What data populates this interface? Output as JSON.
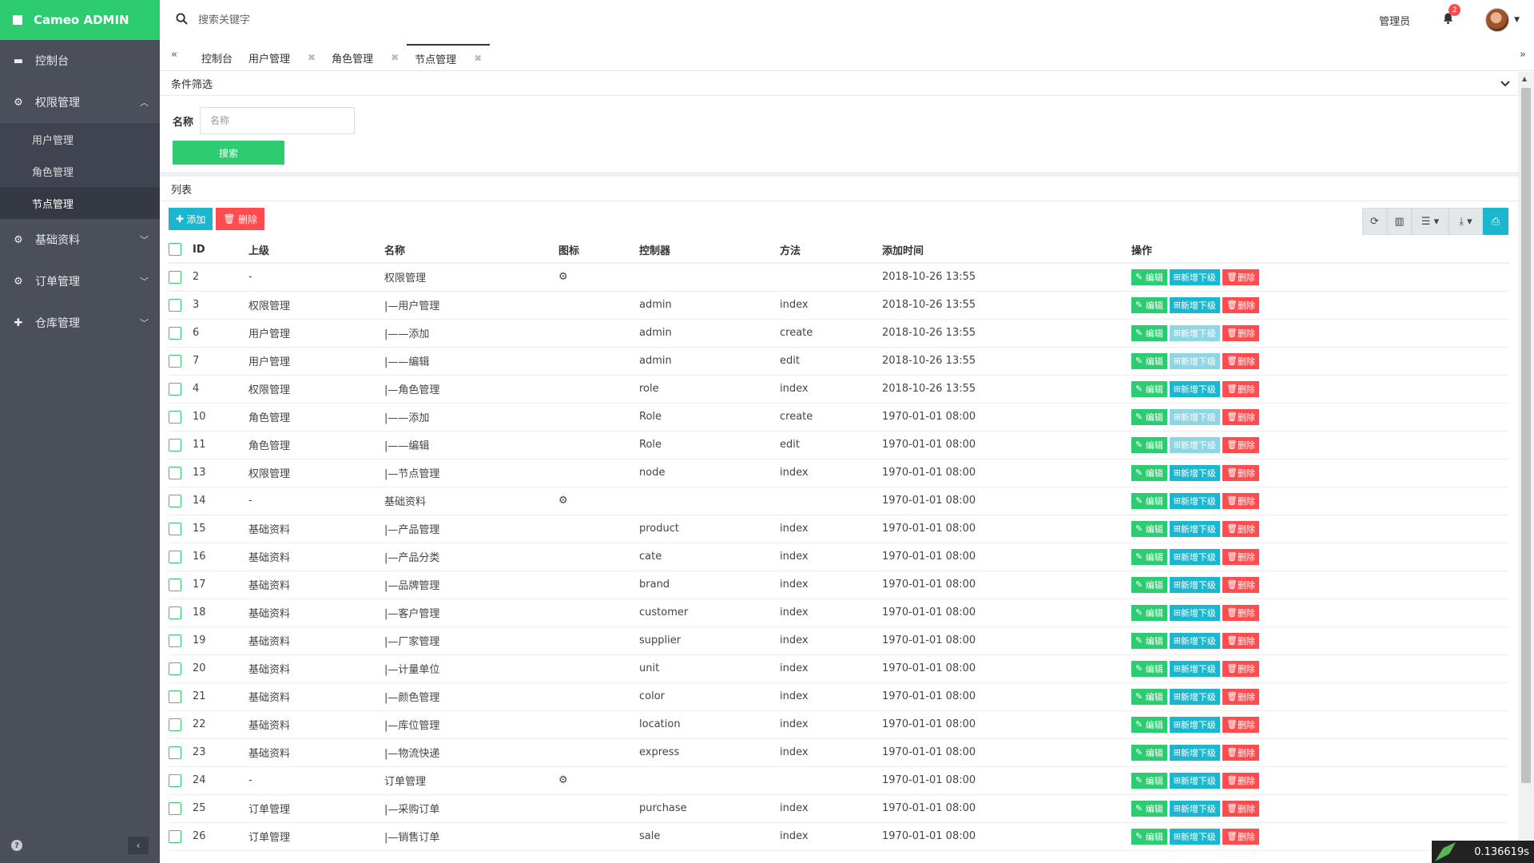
{
  "brand": {
    "title": "Cameo ADMIN"
  },
  "sidebar": {
    "items": [
      {
        "label": "控制台",
        "icon": "dashboard-icon"
      },
      {
        "label": "权限管理",
        "icon": "gears-icon",
        "expanded": true,
        "children": [
          {
            "label": "用户管理"
          },
          {
            "label": "角色管理"
          },
          {
            "label": "节点管理",
            "active": true
          }
        ]
      },
      {
        "label": "基础资料",
        "icon": "gears-icon"
      },
      {
        "label": "订单管理",
        "icon": "gears-icon"
      },
      {
        "label": "仓库管理",
        "icon": "plus-icon"
      }
    ]
  },
  "header": {
    "search_placeholder": "搜索关键字",
    "admin_name": "管理员",
    "notification_count": "2"
  },
  "tabs": [
    {
      "label": "控制台",
      "closable": false
    },
    {
      "label": "用户管理",
      "closable": true
    },
    {
      "label": "角色管理",
      "closable": true
    },
    {
      "label": "节点管理",
      "closable": true,
      "active": true
    }
  ],
  "filter": {
    "title": "条件筛选",
    "name_label": "名称",
    "name_placeholder": "名称",
    "search_button": "搜索"
  },
  "list": {
    "title": "列表",
    "add_button": "添加",
    "delete_button": "删除",
    "columns": [
      "ID",
      "上级",
      "名称",
      "图标",
      "控制器",
      "方法",
      "添加时间",
      "操作"
    ],
    "actions": {
      "edit": "编辑",
      "add_child": "新增下级",
      "delete": "删除"
    },
    "rows": [
      {
        "id": "2",
        "parent": "-",
        "name": "权限管理",
        "icon": true,
        "controller": "",
        "method": "",
        "time": "2018-10-26 13:55",
        "add_child_enabled": true
      },
      {
        "id": "3",
        "parent": "权限管理",
        "name": "|—用户管理",
        "icon": false,
        "controller": "admin",
        "method": "index",
        "time": "2018-10-26 13:55",
        "add_child_enabled": true
      },
      {
        "id": "6",
        "parent": "用户管理",
        "name": "|——添加",
        "icon": false,
        "controller": "admin",
        "method": "create",
        "time": "2018-10-26 13:55",
        "add_child_enabled": false
      },
      {
        "id": "7",
        "parent": "用户管理",
        "name": "|——编辑",
        "icon": false,
        "controller": "admin",
        "method": "edit",
        "time": "2018-10-26 13:55",
        "add_child_enabled": false
      },
      {
        "id": "4",
        "parent": "权限管理",
        "name": "|—角色管理",
        "icon": false,
        "controller": "role",
        "method": "index",
        "time": "2018-10-26 13:55",
        "add_child_enabled": true
      },
      {
        "id": "10",
        "parent": "角色管理",
        "name": "|——添加",
        "icon": false,
        "controller": "Role",
        "method": "create",
        "time": "1970-01-01 08:00",
        "add_child_enabled": false
      },
      {
        "id": "11",
        "parent": "角色管理",
        "name": "|——编辑",
        "icon": false,
        "controller": "Role",
        "method": "edit",
        "time": "1970-01-01 08:00",
        "add_child_enabled": false
      },
      {
        "id": "13",
        "parent": "权限管理",
        "name": "|—节点管理",
        "icon": false,
        "controller": "node",
        "method": "index",
        "time": "1970-01-01 08:00",
        "add_child_enabled": true
      },
      {
        "id": "14",
        "parent": "-",
        "name": "基础资料",
        "icon": true,
        "controller": "",
        "method": "",
        "time": "1970-01-01 08:00",
        "add_child_enabled": true
      },
      {
        "id": "15",
        "parent": "基础资料",
        "name": "|—产品管理",
        "icon": false,
        "controller": "product",
        "method": "index",
        "time": "1970-01-01 08:00",
        "add_child_enabled": true
      },
      {
        "id": "16",
        "parent": "基础资料",
        "name": "|—产品分类",
        "icon": false,
        "controller": "cate",
        "method": "index",
        "time": "1970-01-01 08:00",
        "add_child_enabled": true
      },
      {
        "id": "17",
        "parent": "基础资料",
        "name": "|—品牌管理",
        "icon": false,
        "controller": "brand",
        "method": "index",
        "time": "1970-01-01 08:00",
        "add_child_enabled": true
      },
      {
        "id": "18",
        "parent": "基础资料",
        "name": "|—客户管理",
        "icon": false,
        "controller": "customer",
        "method": "index",
        "time": "1970-01-01 08:00",
        "add_child_enabled": true
      },
      {
        "id": "19",
        "parent": "基础资料",
        "name": "|—厂家管理",
        "icon": false,
        "controller": "supplier",
        "method": "index",
        "time": "1970-01-01 08:00",
        "add_child_enabled": true
      },
      {
        "id": "20",
        "parent": "基础资料",
        "name": "|—计量单位",
        "icon": false,
        "controller": "unit",
        "method": "index",
        "time": "1970-01-01 08:00",
        "add_child_enabled": true
      },
      {
        "id": "21",
        "parent": "基础资料",
        "name": "|—颜色管理",
        "icon": false,
        "controller": "color",
        "method": "index",
        "time": "1970-01-01 08:00",
        "add_child_enabled": true
      },
      {
        "id": "22",
        "parent": "基础资料",
        "name": "|—库位管理",
        "icon": false,
        "controller": "location",
        "method": "index",
        "time": "1970-01-01 08:00",
        "add_child_enabled": true
      },
      {
        "id": "23",
        "parent": "基础资料",
        "name": "|—物流快递",
        "icon": false,
        "controller": "express",
        "method": "index",
        "time": "1970-01-01 08:00",
        "add_child_enabled": true
      },
      {
        "id": "24",
        "parent": "-",
        "name": "订单管理",
        "icon": true,
        "controller": "",
        "method": "",
        "time": "1970-01-01 08:00",
        "add_child_enabled": true
      },
      {
        "id": "25",
        "parent": "订单管理",
        "name": "|—采购订单",
        "icon": false,
        "controller": "purchase",
        "method": "index",
        "time": "1970-01-01 08:00",
        "add_child_enabled": true
      },
      {
        "id": "26",
        "parent": "订单管理",
        "name": "|—销售订单",
        "icon": false,
        "controller": "sale",
        "method": "index",
        "time": "1970-01-01 08:00",
        "add_child_enabled": true
      }
    ]
  },
  "debug": {
    "timer": "0.136619s"
  },
  "colors": {
    "brand": "#2ecc71",
    "sidebar": "#4a4f5a",
    "info": "#1ab7cf",
    "danger": "#ff4d4f"
  }
}
